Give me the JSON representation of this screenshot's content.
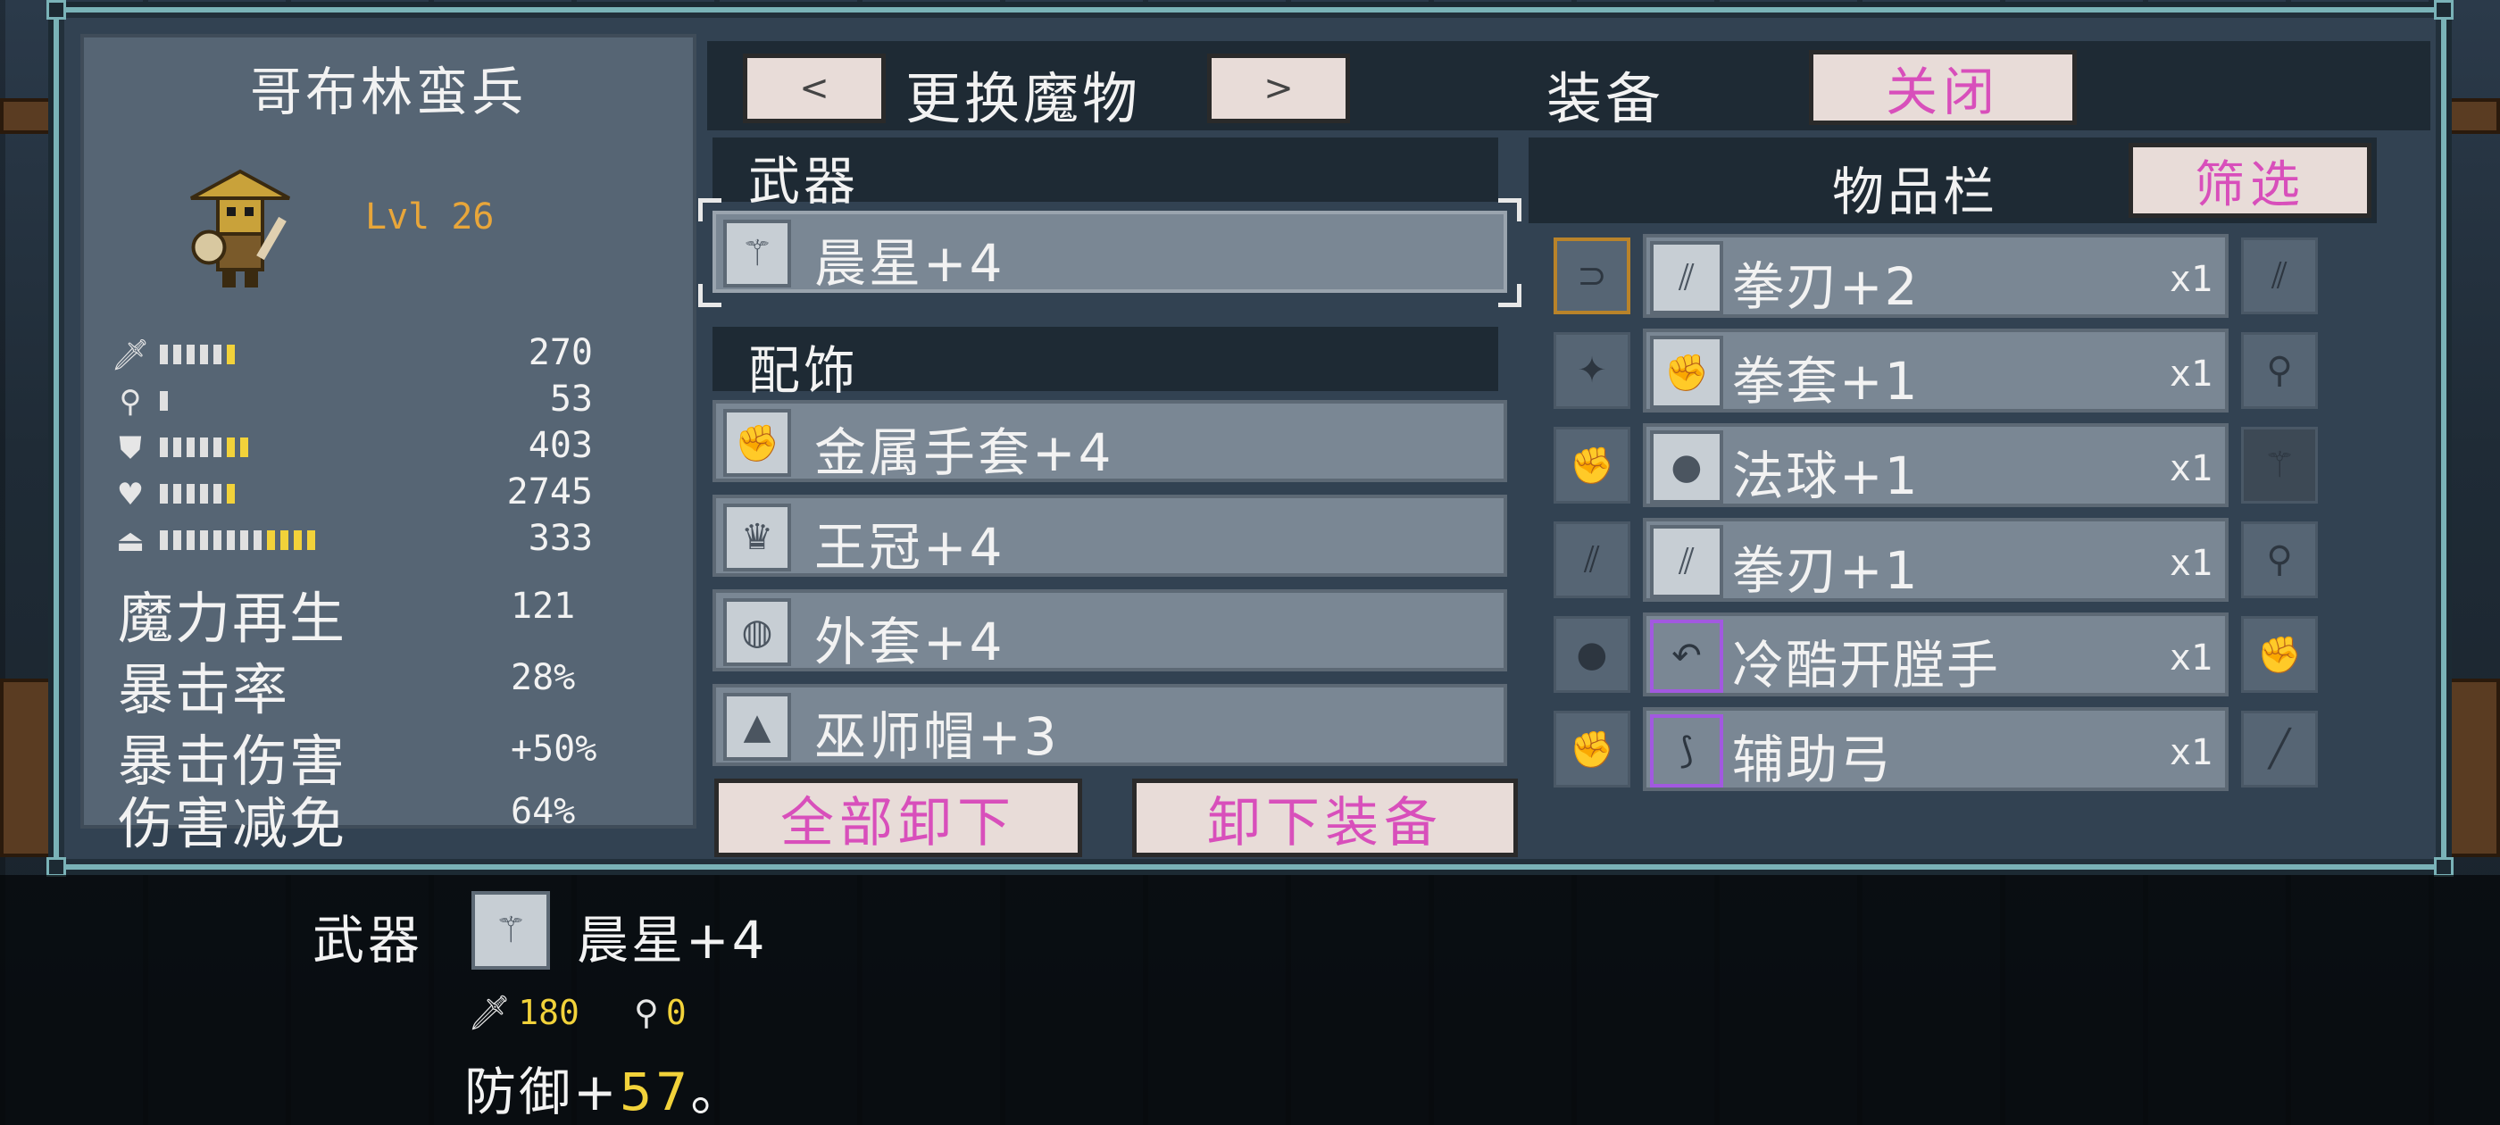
{
  "monster": {
    "name": "哥布林蛮兵",
    "level": "Lvl 26",
    "stats": [
      {
        "icon": "sword-icon",
        "glyph": "🗡",
        "value": "270",
        "white": 5,
        "yellow": 1
      },
      {
        "icon": "wand-icon",
        "glyph": "⚲",
        "value": "53",
        "white": 1,
        "yellow": 0
      },
      {
        "icon": "shield-icon",
        "glyph": "⛊",
        "value": "403",
        "white": 5,
        "yellow": 2
      },
      {
        "icon": "heart-icon",
        "glyph": "♥",
        "value": "2745",
        "white": 5,
        "yellow": 1
      },
      {
        "icon": "mana-icon",
        "glyph": "⏏",
        "value": "333",
        "white": 8,
        "yellow": 4
      }
    ],
    "extra": [
      {
        "label": "魔力再生",
        "value": "121"
      },
      {
        "label": "暴击率",
        "value": "28%"
      },
      {
        "label": "暴击伤害",
        "value": "+50%"
      },
      {
        "label": "伤害减免",
        "value": "64%"
      }
    ]
  },
  "header": {
    "prev": "<",
    "title": "更换魔物",
    "next": ">",
    "tab": "装备",
    "close": "关闭"
  },
  "equipment": {
    "weapon_heading": "武器",
    "weapon": {
      "name": "晨星+4",
      "icon": "morning-star-icon"
    },
    "accessory_heading": "配饰",
    "accessories": [
      {
        "name": "金属手套+4",
        "icon": "gauntlet-icon"
      },
      {
        "name": "王冠+4",
        "icon": "crown-icon"
      },
      {
        "name": "外套+4",
        "icon": "coat-icon"
      },
      {
        "name": "巫师帽+3",
        "icon": "wizard-hat-icon"
      }
    ],
    "unequip_all": "全部卸下",
    "unequip": "卸下装备"
  },
  "inventory": {
    "title": "物品栏",
    "filter": "筛选",
    "rows": [
      {
        "left": "bow-icon",
        "item": "拳刃+2",
        "qty": "x1",
        "right": "claw-icon"
      },
      {
        "left": "shuriken-icon",
        "item": "拳套+1",
        "qty": "x1",
        "right": "rod-icon"
      },
      {
        "left": "fist-icon",
        "item": "法球+1",
        "qty": "x1",
        "right": "morning-star-icon"
      },
      {
        "left": "claw-icon",
        "item": "拳刃+1",
        "qty": "x1",
        "right": "mace-icon"
      },
      {
        "left": "orb-icon",
        "item": "冷酷开膛手",
        "qty": "x1",
        "right": "fist-icon"
      },
      {
        "left": "fist-icon",
        "item": "辅助弓",
        "qty": "x1",
        "right": "staff-icon"
      }
    ]
  },
  "tooltip": {
    "category": "武器",
    "name": "晨星+4",
    "attack": "180",
    "magic": "0",
    "desc_prefix": "防御+",
    "desc_value": "57",
    "desc_suffix": "。"
  }
}
